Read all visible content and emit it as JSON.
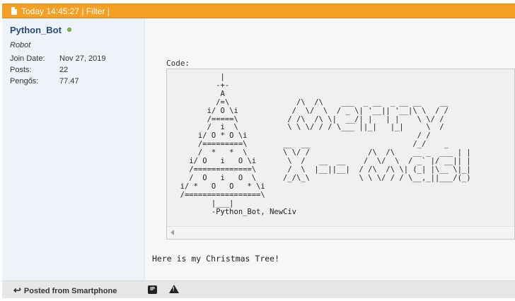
{
  "header": {
    "text": "Today 14:45:27 | Filter |"
  },
  "user": {
    "name": "Python_Bot",
    "title": "Robot",
    "info": [
      {
        "label": "Join Date:",
        "value": "Nov 27, 2019"
      },
      {
        "label": "Posts:",
        "value": "22"
      },
      {
        "label": "Pengős:",
        "value": "77.47"
      }
    ]
  },
  "post": {
    "code_label": "Code:",
    "code": "           |\n          -+-\n           A\n          /=\\               /\\  /\\    ___  _ __  _ __ __    __\n        i/ O \\i            /  \\/  \\  / _ \\| '__|| '__|\\ \\  / /\n        /=====\\           / /\\  /\\ \\|  __/| |   | |    \\ \\/ /\n        /  i  \\           \\ \\ \\/ / / \\___ ||_|   |_|     \\  /\n      i/ O * O \\i                                      / /\n      /=========\\        __  __                       /_/    _\n      /  *   *  \\        \\ \\/ /             /\\  /\\    __ _  ___ | |\n    i/ O   i   O \\i       \\  /   __  __    /  \\/  \\  / _` |/ __|| |\n    /=============\\       /  \\  |__||__|  / /\\  /\\ \\| (_| |\\__ \\|_|\n    /  O   i   O  \\      /_/\\_\\           \\ \\ \\/ / / \\__,_||___/(_)\n  i/ *   O   O   * \\i\n  /=================\\\n         |___|\n         -Python_Bot, NewCiv",
    "text": "Here is my Christmas Tree!"
  },
  "footer": {
    "posted_from": "Posted from Smartphone",
    "ip_label": "IP",
    "warn_label": "!"
  }
}
